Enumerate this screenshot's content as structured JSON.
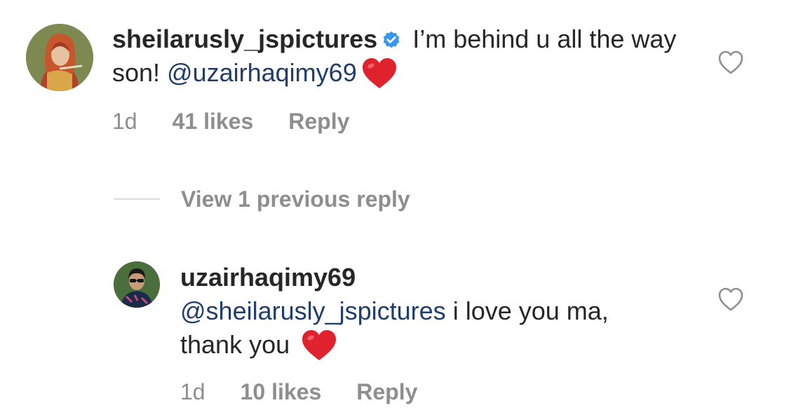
{
  "comments": [
    {
      "username": "sheilarusly_jspictures",
      "verified": true,
      "text_before_mention": " I’m behind u all the way son! ",
      "mention": "@uzairhaqimy69",
      "text_after_mention": "",
      "emoji": "red-heart",
      "time": "1d",
      "likes": "41 likes",
      "reply_label": "Reply"
    },
    {
      "username": "uzairhaqimy69",
      "verified": false,
      "mention": "@sheilarusly_jspictures",
      "text_after_mention": " i love you ma, thank you ",
      "emoji": "red-heart",
      "time": "1d",
      "likes": "10 likes",
      "reply_label": "Reply"
    }
  ],
  "view_replies_label": "View 1 previous reply",
  "colors": {
    "text": "#262626",
    "meta": "#8e8e8e",
    "mention": "#1f3c6b",
    "verified": "#3897f0",
    "heart": "#e0222e",
    "divider": "#dbdbdb"
  },
  "icons": {
    "like": "heart-outline-icon",
    "verified": "verified-badge-icon",
    "emoji": "red-heart-emoji"
  }
}
